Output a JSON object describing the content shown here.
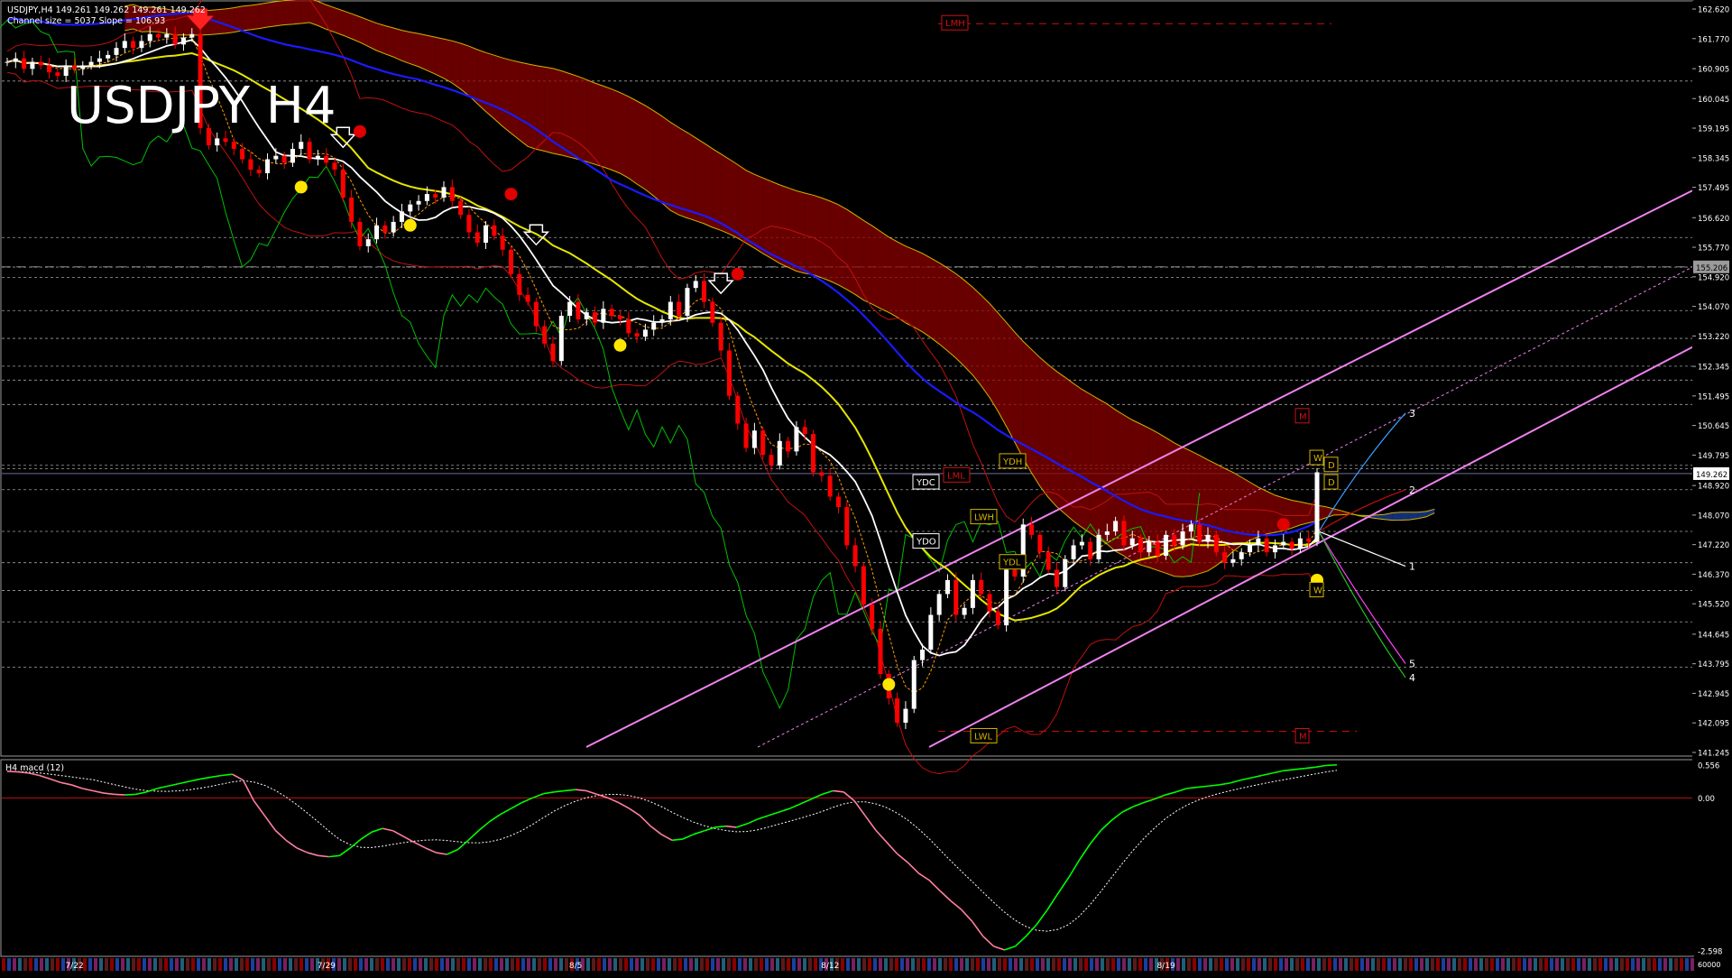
{
  "window": {
    "header_line1": "USDJPY,H4  149.261 149.262 149.261 149.262",
    "header_line2": "Channel size = 5037  Slope = 106.93",
    "watermark": "USDJPY H4"
  },
  "sub_window": {
    "label": "H4  macd (12)"
  },
  "colors": {
    "background": "#000000",
    "bull_candle": "#ffffff",
    "bear_candle": "#ff0000",
    "ma_white": "#ffffff",
    "ma_yellow": "#e6e600",
    "ma_blue": "#1a1aff",
    "channel": "#ee82ee",
    "chikou": "#00c000",
    "kumo_bear": "#8b0000",
    "kumo_bull": "#1a3f9f",
    "macd_up": "#00ff00",
    "macd_down": "#ff7f9f",
    "signal": "#ffffff"
  },
  "chart_data": [
    {
      "type": "candlestick",
      "symbol": "USDJPY",
      "timeframe": "H4",
      "last_price": "149.262",
      "ylim": [
        141.245,
        162.62
      ],
      "y_ticks": [
        "162.620",
        "161.770",
        "160.905",
        "160.045",
        "159.195",
        "158.345",
        "157.495",
        "156.620",
        "155.770",
        "154.920",
        "154.070",
        "153.220",
        "152.345",
        "151.495",
        "150.645",
        "149.795",
        "148.920",
        "148.070",
        "147.220",
        "146.370",
        "145.520",
        "144.645",
        "143.795",
        "142.945",
        "142.095",
        "141.245"
      ],
      "price_label": "155.206",
      "x_date_labels": [
        {
          "label": "7/22",
          "bar": 8
        },
        {
          "label": "7/29",
          "bar": 38
        },
        {
          "label": "8/5",
          "bar": 68
        },
        {
          "label": "8/12",
          "bar": 98
        },
        {
          "label": "8/19",
          "bar": 138
        }
      ],
      "close": [
        161.1,
        161.2,
        160.9,
        161.1,
        161.0,
        160.8,
        160.7,
        161.0,
        160.9,
        161.0,
        161.1,
        161.2,
        161.3,
        161.5,
        161.7,
        161.5,
        161.7,
        161.9,
        161.8,
        161.9,
        161.6,
        161.8,
        161.9,
        159.2,
        158.7,
        158.9,
        158.8,
        158.6,
        158.3,
        158.0,
        157.9,
        158.3,
        158.4,
        158.2,
        158.6,
        158.8,
        158.3,
        158.4,
        158.2,
        158.0,
        157.2,
        156.5,
        155.8,
        156.0,
        156.4,
        156.2,
        156.5,
        156.8,
        157.0,
        157.1,
        157.3,
        157.2,
        157.5,
        157.1,
        156.7,
        156.2,
        155.9,
        156.4,
        156.1,
        155.7,
        155.0,
        154.4,
        154.2,
        153.5,
        153.0,
        152.5,
        153.8,
        154.2,
        153.7,
        153.9,
        153.6,
        154.0,
        153.8,
        153.7,
        153.3,
        153.2,
        153.4,
        153.6,
        153.7,
        154.2,
        153.8,
        154.6,
        154.8,
        154.2,
        153.6,
        152.8,
        151.5,
        150.7,
        150.0,
        150.5,
        149.8,
        149.5,
        150.2,
        149.9,
        150.6,
        150.4,
        149.3,
        149.2,
        148.6,
        148.3,
        147.2,
        146.6,
        145.5,
        144.8,
        143.5,
        142.8,
        142.1,
        142.5,
        143.9,
        144.2,
        145.2,
        145.8,
        146.2,
        145.2,
        145.4,
        146.2,
        145.8,
        145.3,
        144.9,
        146.5,
        146.3,
        147.8,
        147.5,
        147.0,
        146.5,
        146.0,
        146.8,
        147.2,
        147.3,
        146.8,
        147.5,
        147.6,
        147.9,
        147.2,
        147.4,
        147.0,
        147.3,
        146.9,
        147.5,
        147.2,
        147.6,
        147.8,
        147.3,
        147.5,
        147.0,
        146.7,
        146.8,
        147.0,
        147.2,
        147.4,
        147.0,
        147.2,
        147.3,
        147.1,
        147.4,
        147.3,
        149.3
      ],
      "macd": [
        0.45,
        0.44,
        0.42,
        0.38,
        0.32,
        0.26,
        0.22,
        0.16,
        0.12,
        0.08,
        0.06,
        0.05,
        0.06,
        0.1,
        0.16,
        0.2,
        0.24,
        0.28,
        0.32,
        0.35,
        0.38,
        0.4,
        0.3,
        -0.05,
        -0.3,
        -0.55,
        -0.72,
        -0.85,
        -0.93,
        -0.98,
        -1.0,
        -0.98,
        -0.85,
        -0.7,
        -0.58,
        -0.52,
        -0.56,
        -0.66,
        -0.76,
        -0.85,
        -0.93,
        -0.96,
        -0.88,
        -0.72,
        -0.55,
        -0.4,
        -0.28,
        -0.18,
        -0.08,
        0.0,
        0.07,
        0.1,
        0.12,
        0.14,
        0.12,
        0.06,
        0.0,
        -0.08,
        -0.18,
        -0.3,
        -0.48,
        -0.62,
        -0.72,
        -0.7,
        -0.62,
        -0.56,
        -0.5,
        -0.48,
        -0.5,
        -0.44,
        -0.36,
        -0.3,
        -0.24,
        -0.18,
        -0.1,
        -0.02,
        0.06,
        0.12,
        0.1,
        -0.05,
        -0.3,
        -0.55,
        -0.75,
        -0.95,
        -1.1,
        -1.28,
        -1.4,
        -1.58,
        -1.75,
        -1.9,
        -2.1,
        -2.35,
        -2.52,
        -2.58,
        -2.52,
        -2.35,
        -2.15,
        -1.9,
        -1.62,
        -1.35,
        -1.05,
        -0.78,
        -0.55,
        -0.38,
        -0.24,
        -0.15,
        -0.08,
        -0.02,
        0.05,
        0.1,
        0.16,
        0.18,
        0.2,
        0.22,
        0.25,
        0.3,
        0.34,
        0.38,
        0.42,
        0.46,
        0.48,
        0.5,
        0.52,
        0.55,
        0.56
      ],
      "macd_ylim": [
        -2.598,
        0.556
      ],
      "macd_y_ticks": [
        "0.556",
        "0.00",
        "-2.598"
      ],
      "macd_extra_tick": "60000",
      "channel_labels": [
        "3",
        "2",
        "1",
        "5",
        "4"
      ],
      "annotations": [
        "LMH",
        "YDC",
        "LML",
        "YDH",
        "LWH",
        "YDO",
        "YDL",
        "LWL",
        "M",
        "M",
        "W",
        "W",
        "D",
        "D"
      ]
    }
  ]
}
